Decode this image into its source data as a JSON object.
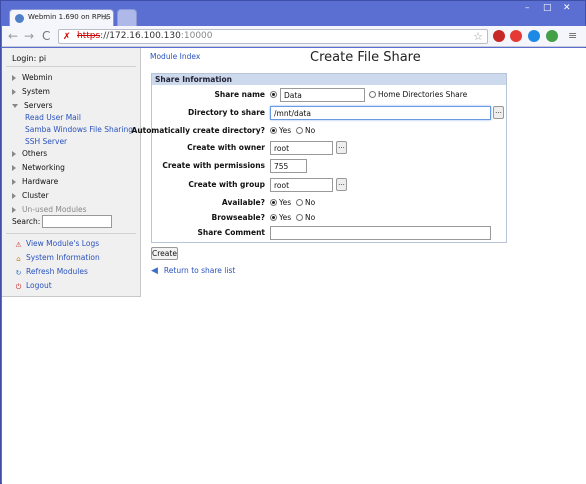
{
  "browser": {
    "tab_title": "Webmin 1.690 on RPHS (",
    "tab_close": "×",
    "minimize": "–",
    "maximize": "□",
    "close": "✕",
    "back": "←",
    "forward": "→",
    "reload": "C",
    "url_scheme": "https",
    "url_rest": "://172.16.100.130",
    "url_port": ":10000",
    "star": "☆",
    "extension_colors": [
      "#c62828",
      "#e53935",
      "#1e88e5",
      "#43a047"
    ]
  },
  "sidebar": {
    "login": "Login: pi",
    "categories": [
      {
        "label": "Webmin",
        "expanded": false
      },
      {
        "label": "System",
        "expanded": false
      },
      {
        "label": "Servers",
        "expanded": true
      },
      {
        "label": "Others",
        "expanded": false
      },
      {
        "label": "Networking",
        "expanded": false
      },
      {
        "label": "Hardware",
        "expanded": false
      },
      {
        "label": "Cluster",
        "expanded": false
      },
      {
        "label": "Un-used Modules",
        "expanded": false
      }
    ],
    "server_items": [
      "Read User Mail",
      "Samba Windows File Sharing",
      "SSH Server"
    ],
    "search_label": "Search:",
    "search_value": "",
    "actions": [
      "View Module's Logs",
      "System Information",
      "Refresh Modules",
      "Logout"
    ]
  },
  "main": {
    "module_index": "Module Index",
    "title": "Create File Share",
    "panel_title": "Share Information",
    "fields": {
      "share_name": {
        "label": "Share name",
        "value": "Data",
        "alt_option": "Home Directories Share"
      },
      "directory": {
        "label": "Directory to share",
        "value": "/mnt/data"
      },
      "auto_create": {
        "label": "Automatically create directory?",
        "yes": "Yes",
        "no": "No",
        "selected": "Yes"
      },
      "owner": {
        "label": "Create with owner",
        "value": "root"
      },
      "permissions": {
        "label": "Create with permissions",
        "value": "755"
      },
      "group": {
        "label": "Create with group",
        "value": "root"
      },
      "available": {
        "label": "Available?",
        "yes": "Yes",
        "no": "No",
        "selected": "Yes"
      },
      "browseable": {
        "label": "Browseable?",
        "yes": "Yes",
        "no": "No",
        "selected": "Yes"
      },
      "comment": {
        "label": "Share Comment",
        "value": ""
      }
    },
    "browse_label": "...",
    "create_button": "Create",
    "return_link": "Return to share list"
  }
}
